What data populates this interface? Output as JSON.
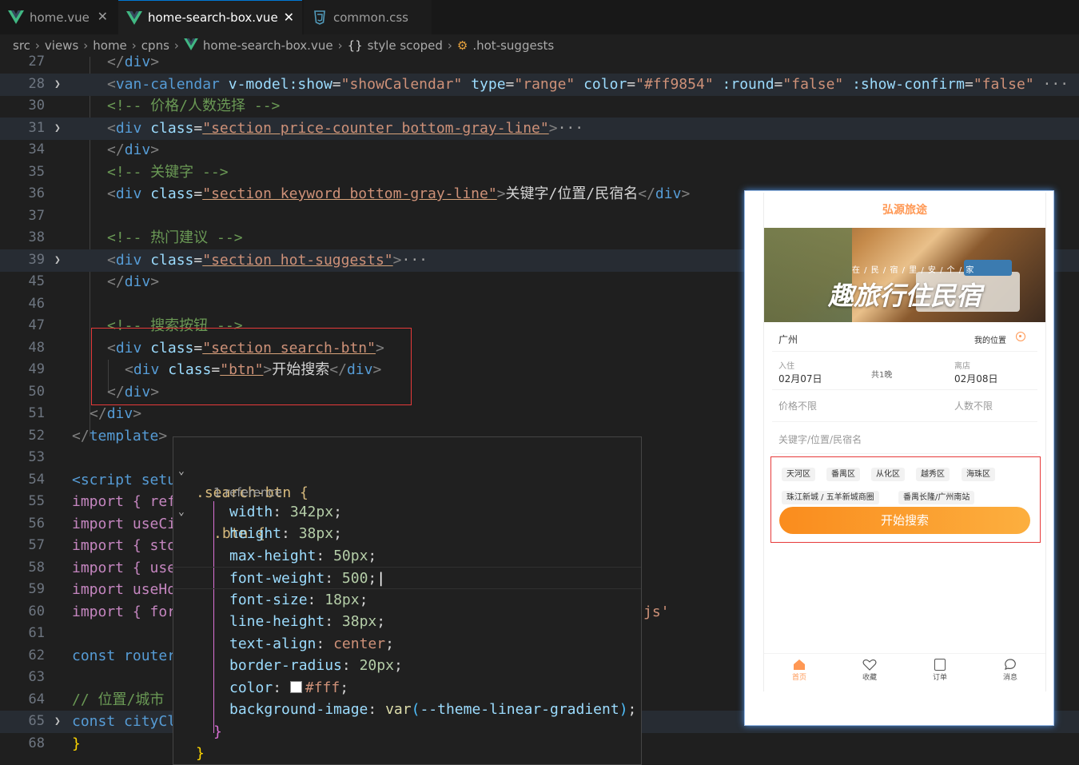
{
  "tabs": [
    {
      "label": "home.vue",
      "icon": "vue-icon",
      "active": false
    },
    {
      "label": "home-search-box.vue",
      "icon": "vue-icon",
      "active": true
    },
    {
      "label": "common.css",
      "icon": "css-icon",
      "active": false
    }
  ],
  "breadcrumb": [
    "src",
    "views",
    "home",
    "cpns",
    "home-search-box.vue",
    "style scoped",
    ".hot-suggests"
  ],
  "line_numbers": [
    "27",
    "28",
    "30",
    "31",
    "34",
    "35",
    "36",
    "37",
    "38",
    "39",
    "45",
    "46",
    "47",
    "48",
    "49",
    "50",
    "51",
    "52",
    "53",
    "54",
    "55",
    "56",
    "57",
    "58",
    "59",
    "60",
    "61",
    "62",
    "63",
    "64",
    "65",
    "68"
  ],
  "code": {
    "l28": {
      "tag": "van-calendar",
      "a1": "v-model:show",
      "v1": "\"showCalendar\"",
      "a2": "type",
      "v2": "\"range\"",
      "a3": "color",
      "v3": "\"#ff9854\"",
      "a4": ":round",
      "v4": "\"false\"",
      "a5": ":show-confirm",
      "v5": "\"false\""
    },
    "l30": "<!-- 价格/人数选择 -->",
    "l31_class": "\"section price-counter bottom-gray-line\"",
    "l35": "<!-- 关键字 -->",
    "l36_class": "\"section keyword bottom-gray-line\"",
    "l36_text": "关键字/位置/民宿名",
    "l38": "<!-- 热门建议 -->",
    "l39_class": "\"section hot-suggests\"",
    "l47": "<!-- 搜索按钮 -->",
    "l48_class": "\"section search-btn\"",
    "l49_class": "\"btn\"",
    "l49_text": "开始搜索",
    "l54": "<script setu",
    "l55": "import { ref",
    "l56": "import useCi",
    "l57": "import { sto",
    "l58": "import { use",
    "l59": "import useHo",
    "l60": "import { for",
    "l60_tail": "js'",
    "l62": "const router",
    "l64": "// 位置/城市",
    "l65": "const cityCl",
    "l68": "}"
  },
  "peek": {
    "selector": ".search-btn {",
    "references": "1 reference",
    "inner_selector": ".btn {",
    "declarations": [
      {
        "prop": "width",
        "value": "342px"
      },
      {
        "prop": "height",
        "value": "38px"
      },
      {
        "prop": "max-height",
        "value": "50px"
      },
      {
        "prop": "font-weight",
        "value": "500"
      },
      {
        "prop": "font-size",
        "value": "18px"
      },
      {
        "prop": "line-height",
        "value": "38px"
      },
      {
        "prop": "text-align",
        "value": "center"
      },
      {
        "prop": "border-radius",
        "value": "20px"
      },
      {
        "prop": "color",
        "value": "#fff"
      },
      {
        "prop": "background-image",
        "fn": "var",
        "arg": "--theme-linear-gradient"
      }
    ],
    "close_inner": "}",
    "close_outer": "}"
  },
  "phone": {
    "title": "弘源旅途",
    "banner_small": "在 / 民 / 宿 / 里 / 安 / 个 / 家",
    "banner_big": "趣旅行住民宿",
    "city": "广州",
    "my_location": "我的位置",
    "checkin_label": "入住",
    "checkin_date": "02月07日",
    "nights": "共1晚",
    "checkout_label": "离店",
    "checkout_date": "02月08日",
    "price": "价格不限",
    "people": "人数不限",
    "keyword_placeholder": "关键字/位置/民宿名",
    "hot_tags": [
      "天河区",
      "番禺区",
      "从化区",
      "越秀区",
      "海珠区",
      "珠江新城 / 五羊新城商圈",
      "番禺长隆/广州南站"
    ],
    "search_button": "开始搜索",
    "tabbar": [
      "首页",
      "收藏",
      "订单",
      "消息"
    ],
    "theme_color": "#ff9854"
  }
}
